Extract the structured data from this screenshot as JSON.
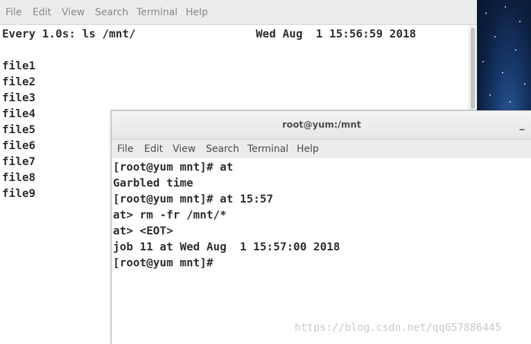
{
  "background_terminal": {
    "menu": [
      "File",
      "Edit",
      "View",
      "Search",
      "Terminal",
      "Help"
    ],
    "lines": [
      "Every 1.0s: ls /mnt/                  Wed Aug  1 15:56:59 2018",
      "",
      "file1",
      "file2",
      "file3",
      "file4",
      "file5",
      "file6",
      "file7",
      "file8",
      "file9"
    ]
  },
  "foreground_terminal": {
    "title": "root@yum:/mnt",
    "minimize_glyph": "_",
    "menu": [
      "File",
      "Edit",
      "View",
      "Search",
      "Terminal",
      "Help"
    ],
    "lines": [
      "[root@yum mnt]# at",
      "Garbled time",
      "[root@yum mnt]# at 15:57",
      "at> rm -fr /mnt/*",
      "at> <EOT>",
      "job 11 at Wed Aug  1 15:57:00 2018",
      "[root@yum mnt]#"
    ]
  },
  "watermark": "https://blog.csdn.net/qq657886445",
  "colors": {
    "menubar": "#ececec",
    "terminal_text": "#2e2e2e",
    "desktop_sky": "#0c1f3f"
  }
}
